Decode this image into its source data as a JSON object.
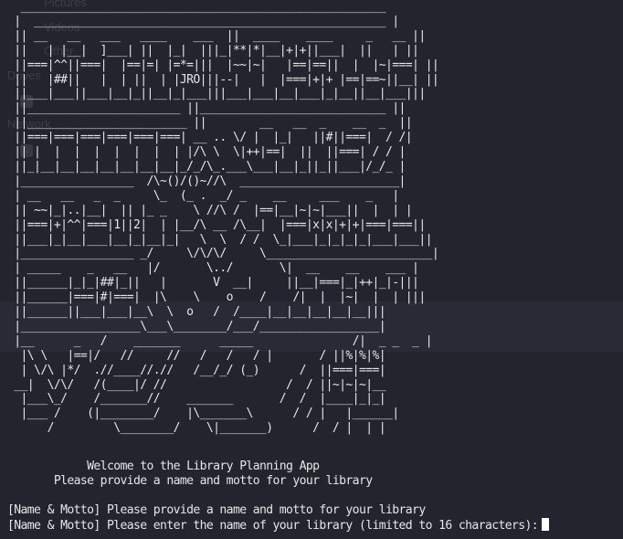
{
  "background_window": {
    "sidebar_items": [
      "Pictures",
      "Videos",
      "Other",
      "Drives",
      "Network"
    ]
  },
  "terminal": {
    "ascii_art": "  _______________________________________________________\n |  _____________________________________________________ |\n || __   __   ___   ____    ___  ||  ____    ____     _   __ ||\n ||   | |__|  ]___| ||  |_|  |||_|**|*|__|+|+||___|  ||   | ||\n ||===|^^||===|  |==|=| |=*=|||  |~~|~|   |==|==||  |  |~|===| ||\n ||   |##||   |  | ||  | |JRO|||--|   |  |===|+|+ |==|==~||__| ||\n ||___|___||___|__|_||__|_|___|||___|___|__|___|_|__||__|___|||\n ||_______________________ ||____________________________ ||\n ||________________________ ||        __   __  _    __  _  ||\n ||===|===|===|===|===|===| __ .. \\/ |  |_|   ||#||===|  / /|\n || |  |  |  |  |  |  |  | |/\\ \\  \\|++|==|  ||  ||===| / / |\n ||_|__|__|__|__|__|__|__|_/_/\\_.___\\___|__|_||_||___|/_/_ |\n |_________________  /\\~()/()~//\\  ________________________|\n | __   __   _  _     \\_  (_ .  _/ _    __     ___    _   |\n || ~~|_|..|__|  || |_ _    \\ //\\ /  |==|__|~|~|___||  |  | |\n ||===|+|^^|===|1||2|  | |__/\\ __ /\\__|  |===|x|x|+|+|===|===||\n ||___|_|__|___|__|_|__|_|   \\  \\  / /  \\_|___|_|_|_|_|___|___||\n |_________________ _/     \\/\\/\\/     \\_________________________|\n | _____    _   __   |/       \\../       \\|  __    __    ___ |\n ||______|_|_|##|_||   |       V  __|     ||__|===|_|++|_|-|||\n ||______|===|#|===|  |\\    \\    o    /    /|  |  |~|  |  | |||\n ||______||___|___|__\\  \\  o   /  /____|__|__|__|__|__|||\n |__________________\\___\\________/___/__________________|\n |__      _   /    _______      _____               /|  _ _  _ |\n  |\\ \\   |==|/   //     //   /   /   / |       / ||%|%|%|\n  | \\/\\ |*/  .//____//.//   /__/_/ (_)      /  ||===|===|\n __|  \\/\\/   /(____|/ //                  /  / ||~|~|~|__\n  |___\\_/    /_______//    _______       /  /  |____|_|_|\n  |___ /    (|________/    |\\_______\\      / / |   |______|\n      /         \\________/    \\|_______)      /  / |  | |",
    "welcome_line_1": "            Welcome to the Library Planning App",
    "welcome_line_2": "       Please provide a name and motto for your library",
    "prompt_line_1": "[Name & Motto] Please provide a name and motto for your library",
    "prompt_line_2": "[Name & Motto] Please enter the name of your library (limited to 16 characters):"
  },
  "colors": {
    "terminal_background": "#22252e",
    "text": "#e6e6e6",
    "cursor": "#ffffff"
  }
}
